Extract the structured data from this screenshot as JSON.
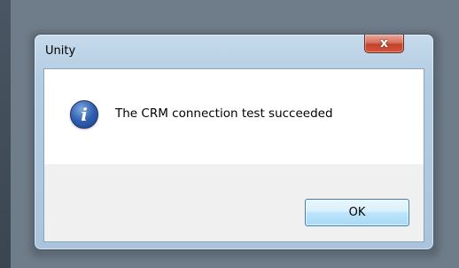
{
  "dialog": {
    "title": "Unity",
    "close_glyph": "x",
    "message": "The CRM connection test succeeded",
    "icon": "info-icon",
    "icon_glyph": "i",
    "ok_label": "OK"
  },
  "colors": {
    "desktop": "#6f7d8a",
    "frame": "#b4cde3",
    "close_button": "#c2412b",
    "content": "#ffffff",
    "footer": "#f0f0f0",
    "ok_button": "#bee6fd",
    "icon": "#2f5faf"
  }
}
